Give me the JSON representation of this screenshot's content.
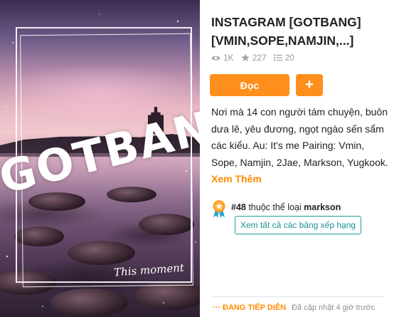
{
  "cover": {
    "title_art": "GOTBANG",
    "signature": "This moment"
  },
  "story": {
    "title": "INSTAGRAM [GOTBANG] [VMIN,SOPE,NAMJIN,...]",
    "stats": {
      "reads": "1K",
      "votes": "227",
      "parts": "20"
    },
    "read_button": "Đọc",
    "add_button": "+",
    "description": "Nơi mà 14 con người tám chuyện, buôn dưa lê, yêu đương, ngọt ngào sến sẩm các kiểu. Au: It's me Pairing: Vmin, Sope, Namjin, 2Jae, Markson, Yugkook.",
    "see_more": "Xem Thêm",
    "rank": {
      "number": "#48",
      "middle": " thuộc thể loại ",
      "category": "markson"
    },
    "all_ranks_button": "Xem tất cả các bảng xếp hạng",
    "status_ongoing": "ĐANG TIẾP DIỄN",
    "status_updated": "Đã cập nhật 4 giờ trước"
  },
  "colors": {
    "accent": "#ff8f1c",
    "teal": "#1e9ba0"
  },
  "icons": [
    "eye-icon",
    "star-icon",
    "list-icon",
    "medal-icon"
  ]
}
